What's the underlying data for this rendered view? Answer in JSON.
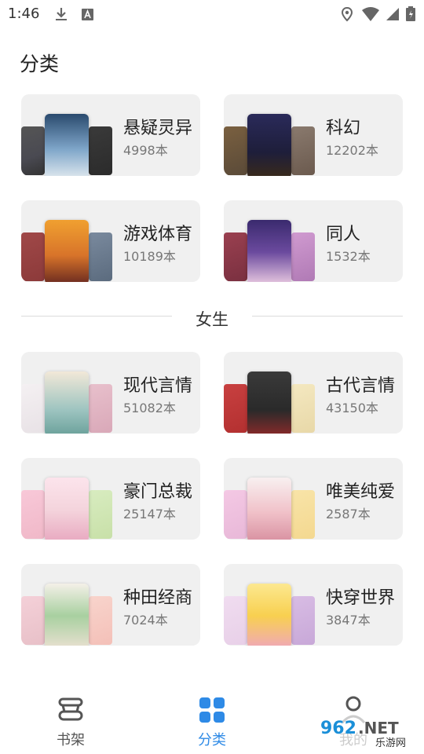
{
  "status_bar": {
    "time": "1:46",
    "icons": [
      "download-icon",
      "a-icon",
      "location-icon",
      "wifi-icon",
      "signal-icon",
      "battery-icon"
    ]
  },
  "page": {
    "title": "分类"
  },
  "sections": [
    {
      "categories": [
        {
          "name": "悬疑灵异",
          "count": "4998本",
          "covers": [
            "#4a4a52",
            "#7fa6c9",
            "#2b2b2b"
          ]
        },
        {
          "name": "科幻",
          "count": "12202本",
          "covers": [
            "#5a4a38",
            "#1e1e3a",
            "#6b5a4e"
          ]
        },
        {
          "name": "游戏体育",
          "count": "10189本",
          "covers": [
            "#8c3a3a",
            "#d8742a",
            "#5b6b7e"
          ]
        },
        {
          "name": "同人",
          "count": "1532本",
          "covers": [
            "#7a3040",
            "#6b4a9e",
            "#b07ab5"
          ]
        }
      ]
    },
    {
      "heading": "女生",
      "categories": [
        {
          "name": "现代言情",
          "count": "51082本",
          "covers": [
            "#e8e2e6",
            "#9dc4c0",
            "#d9a8b8"
          ]
        },
        {
          "name": "古代言情",
          "count": "43150本",
          "covers": [
            "#b33030",
            "#2a2a2a",
            "#e8d8a8"
          ]
        },
        {
          "name": "豪门总裁",
          "count": "25147本",
          "covers": [
            "#f0b8c8",
            "#f4d4dc",
            "#c8e0a8"
          ]
        },
        {
          "name": "唯美纯爱",
          "count": "2587本",
          "covers": [
            "#e8b8d8",
            "#f0c0c8",
            "#f4d890"
          ]
        },
        {
          "name": "种田经商",
          "count": "7024本",
          "covers": [
            "#e8c0c8",
            "#a8d0a0",
            "#f4c0b8"
          ]
        },
        {
          "name": "快穿世界",
          "count": "3847本",
          "covers": [
            "#e8d0e8",
            "#f8d050",
            "#c8a8d8"
          ]
        }
      ]
    }
  ],
  "bottom_nav": [
    {
      "label": "书架",
      "icon": "bookshelf-icon",
      "active": false
    },
    {
      "label": "分类",
      "icon": "grid-icon",
      "active": true
    },
    {
      "label": "我的",
      "icon": "profile-icon",
      "active": false
    }
  ],
  "colors": {
    "accent": "#2e8ae6",
    "inactive": "#555555",
    "card_bg": "#f0f0f0"
  },
  "watermark": {
    "text": "962.NET",
    "subtext": "乐游网"
  }
}
